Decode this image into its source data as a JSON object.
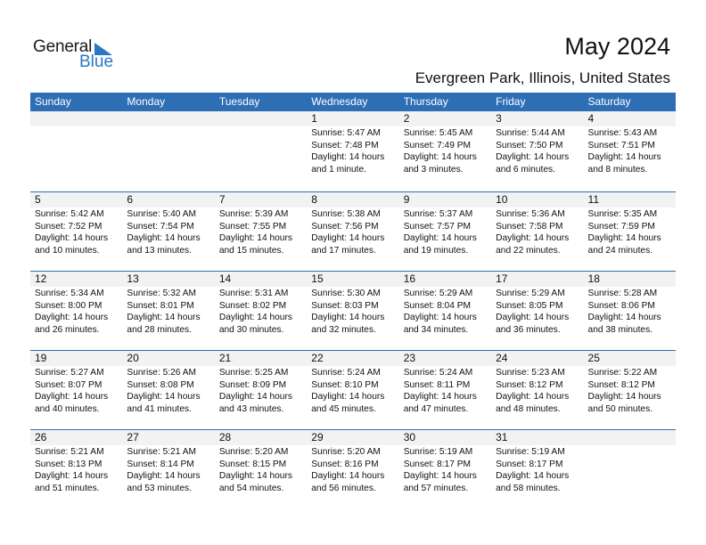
{
  "logo": {
    "general": "General",
    "blue": "Blue"
  },
  "header": {
    "title": "May 2024",
    "location": "Evergreen Park, Illinois, United States"
  },
  "colors": {
    "accent": "#2e6eb5",
    "day_bar": "#f2f2f2",
    "logo_blue": "#2a78c4"
  },
  "weekdays": [
    "Sunday",
    "Monday",
    "Tuesday",
    "Wednesday",
    "Thursday",
    "Friday",
    "Saturday"
  ],
  "weeks": [
    [
      null,
      null,
      null,
      {
        "day": "1",
        "sunrise": "Sunrise: 5:47 AM",
        "sunset": "Sunset: 7:48 PM",
        "daylight": "Daylight: 14 hours",
        "daylight2": "and 1 minute."
      },
      {
        "day": "2",
        "sunrise": "Sunrise: 5:45 AM",
        "sunset": "Sunset: 7:49 PM",
        "daylight": "Daylight: 14 hours",
        "daylight2": "and 3 minutes."
      },
      {
        "day": "3",
        "sunrise": "Sunrise: 5:44 AM",
        "sunset": "Sunset: 7:50 PM",
        "daylight": "Daylight: 14 hours",
        "daylight2": "and 6 minutes."
      },
      {
        "day": "4",
        "sunrise": "Sunrise: 5:43 AM",
        "sunset": "Sunset: 7:51 PM",
        "daylight": "Daylight: 14 hours",
        "daylight2": "and 8 minutes."
      }
    ],
    [
      {
        "day": "5",
        "sunrise": "Sunrise: 5:42 AM",
        "sunset": "Sunset: 7:52 PM",
        "daylight": "Daylight: 14 hours",
        "daylight2": "and 10 minutes."
      },
      {
        "day": "6",
        "sunrise": "Sunrise: 5:40 AM",
        "sunset": "Sunset: 7:54 PM",
        "daylight": "Daylight: 14 hours",
        "daylight2": "and 13 minutes."
      },
      {
        "day": "7",
        "sunrise": "Sunrise: 5:39 AM",
        "sunset": "Sunset: 7:55 PM",
        "daylight": "Daylight: 14 hours",
        "daylight2": "and 15 minutes."
      },
      {
        "day": "8",
        "sunrise": "Sunrise: 5:38 AM",
        "sunset": "Sunset: 7:56 PM",
        "daylight": "Daylight: 14 hours",
        "daylight2": "and 17 minutes."
      },
      {
        "day": "9",
        "sunrise": "Sunrise: 5:37 AM",
        "sunset": "Sunset: 7:57 PM",
        "daylight": "Daylight: 14 hours",
        "daylight2": "and 19 minutes."
      },
      {
        "day": "10",
        "sunrise": "Sunrise: 5:36 AM",
        "sunset": "Sunset: 7:58 PM",
        "daylight": "Daylight: 14 hours",
        "daylight2": "and 22 minutes."
      },
      {
        "day": "11",
        "sunrise": "Sunrise: 5:35 AM",
        "sunset": "Sunset: 7:59 PM",
        "daylight": "Daylight: 14 hours",
        "daylight2": "and 24 minutes."
      }
    ],
    [
      {
        "day": "12",
        "sunrise": "Sunrise: 5:34 AM",
        "sunset": "Sunset: 8:00 PM",
        "daylight": "Daylight: 14 hours",
        "daylight2": "and 26 minutes."
      },
      {
        "day": "13",
        "sunrise": "Sunrise: 5:32 AM",
        "sunset": "Sunset: 8:01 PM",
        "daylight": "Daylight: 14 hours",
        "daylight2": "and 28 minutes."
      },
      {
        "day": "14",
        "sunrise": "Sunrise: 5:31 AM",
        "sunset": "Sunset: 8:02 PM",
        "daylight": "Daylight: 14 hours",
        "daylight2": "and 30 minutes."
      },
      {
        "day": "15",
        "sunrise": "Sunrise: 5:30 AM",
        "sunset": "Sunset: 8:03 PM",
        "daylight": "Daylight: 14 hours",
        "daylight2": "and 32 minutes."
      },
      {
        "day": "16",
        "sunrise": "Sunrise: 5:29 AM",
        "sunset": "Sunset: 8:04 PM",
        "daylight": "Daylight: 14 hours",
        "daylight2": "and 34 minutes."
      },
      {
        "day": "17",
        "sunrise": "Sunrise: 5:29 AM",
        "sunset": "Sunset: 8:05 PM",
        "daylight": "Daylight: 14 hours",
        "daylight2": "and 36 minutes."
      },
      {
        "day": "18",
        "sunrise": "Sunrise: 5:28 AM",
        "sunset": "Sunset: 8:06 PM",
        "daylight": "Daylight: 14 hours",
        "daylight2": "and 38 minutes."
      }
    ],
    [
      {
        "day": "19",
        "sunrise": "Sunrise: 5:27 AM",
        "sunset": "Sunset: 8:07 PM",
        "daylight": "Daylight: 14 hours",
        "daylight2": "and 40 minutes."
      },
      {
        "day": "20",
        "sunrise": "Sunrise: 5:26 AM",
        "sunset": "Sunset: 8:08 PM",
        "daylight": "Daylight: 14 hours",
        "daylight2": "and 41 minutes."
      },
      {
        "day": "21",
        "sunrise": "Sunrise: 5:25 AM",
        "sunset": "Sunset: 8:09 PM",
        "daylight": "Daylight: 14 hours",
        "daylight2": "and 43 minutes."
      },
      {
        "day": "22",
        "sunrise": "Sunrise: 5:24 AM",
        "sunset": "Sunset: 8:10 PM",
        "daylight": "Daylight: 14 hours",
        "daylight2": "and 45 minutes."
      },
      {
        "day": "23",
        "sunrise": "Sunrise: 5:24 AM",
        "sunset": "Sunset: 8:11 PM",
        "daylight": "Daylight: 14 hours",
        "daylight2": "and 47 minutes."
      },
      {
        "day": "24",
        "sunrise": "Sunrise: 5:23 AM",
        "sunset": "Sunset: 8:12 PM",
        "daylight": "Daylight: 14 hours",
        "daylight2": "and 48 minutes."
      },
      {
        "day": "25",
        "sunrise": "Sunrise: 5:22 AM",
        "sunset": "Sunset: 8:12 PM",
        "daylight": "Daylight: 14 hours",
        "daylight2": "and 50 minutes."
      }
    ],
    [
      {
        "day": "26",
        "sunrise": "Sunrise: 5:21 AM",
        "sunset": "Sunset: 8:13 PM",
        "daylight": "Daylight: 14 hours",
        "daylight2": "and 51 minutes."
      },
      {
        "day": "27",
        "sunrise": "Sunrise: 5:21 AM",
        "sunset": "Sunset: 8:14 PM",
        "daylight": "Daylight: 14 hours",
        "daylight2": "and 53 minutes."
      },
      {
        "day": "28",
        "sunrise": "Sunrise: 5:20 AM",
        "sunset": "Sunset: 8:15 PM",
        "daylight": "Daylight: 14 hours",
        "daylight2": "and 54 minutes."
      },
      {
        "day": "29",
        "sunrise": "Sunrise: 5:20 AM",
        "sunset": "Sunset: 8:16 PM",
        "daylight": "Daylight: 14 hours",
        "daylight2": "and 56 minutes."
      },
      {
        "day": "30",
        "sunrise": "Sunrise: 5:19 AM",
        "sunset": "Sunset: 8:17 PM",
        "daylight": "Daylight: 14 hours",
        "daylight2": "and 57 minutes."
      },
      {
        "day": "31",
        "sunrise": "Sunrise: 5:19 AM",
        "sunset": "Sunset: 8:17 PM",
        "daylight": "Daylight: 14 hours",
        "daylight2": "and 58 minutes."
      },
      null
    ]
  ]
}
